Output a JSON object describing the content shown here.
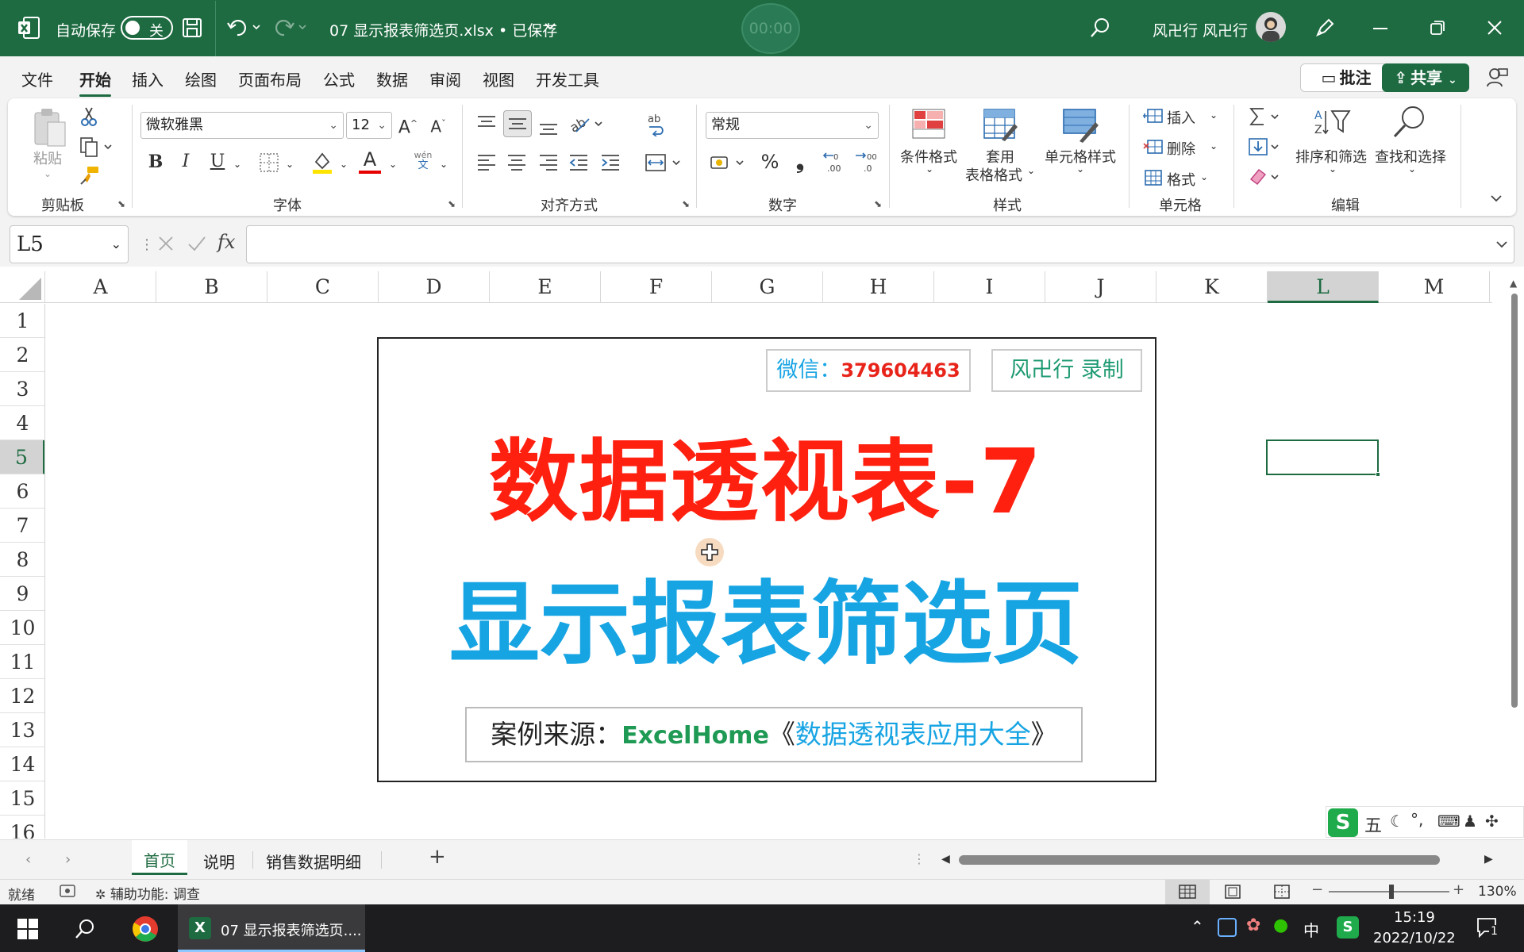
{
  "titlebar": {
    "autosave_label": "自动保存",
    "autosave_state": "关",
    "doc_title": "07 显示报表筛选页.xlsx • 已保存",
    "timer": "00:00",
    "user_name": "风卍行 风卍行",
    "accent_color": "#1e6b41"
  },
  "menu": {
    "items": [
      "文件",
      "开始",
      "插入",
      "绘图",
      "页面布局",
      "公式",
      "数据",
      "审阅",
      "视图",
      "开发工具"
    ],
    "active": "开始",
    "comment_label": "批注",
    "share_label": "共享"
  },
  "ribbon": {
    "clipboard": {
      "paste_label": "粘贴",
      "group_label": "剪贴板"
    },
    "font": {
      "font_name": "微软雅黑",
      "font_size": "12",
      "group_label": "字体",
      "bold": "B",
      "italic": "I",
      "underline": "U",
      "wen": "wén",
      "wen2": "文",
      "font_color_a": "A"
    },
    "alignment": {
      "group_label": "对齐方式"
    },
    "number": {
      "format": "常规",
      "group_label": "数字",
      "percent": "%",
      "comma": "❟"
    },
    "styles": {
      "conditional": "条件格式",
      "table_format_1": "套用",
      "table_format_2": "表格格式",
      "cell_styles": "单元格样式",
      "group_label": "样式"
    },
    "cells": {
      "insert": "插入",
      "delete": "删除",
      "format": "格式",
      "group_label": "单元格"
    },
    "editing": {
      "sort_filter": "排序和筛选",
      "find_select": "查找和选择",
      "group_label": "编辑"
    }
  },
  "formula_bar": {
    "name_box": "L5",
    "fx": "fx",
    "content": ""
  },
  "grid": {
    "columns": [
      "A",
      "B",
      "C",
      "D",
      "E",
      "F",
      "G",
      "H",
      "I",
      "J",
      "K",
      "L",
      "M"
    ],
    "rows": [
      "1",
      "2",
      "3",
      "4",
      "5",
      "6",
      "7",
      "8",
      "9",
      "10",
      "11",
      "12",
      "13",
      "14",
      "15",
      "16"
    ],
    "selected_col": "L",
    "selected_row": "5"
  },
  "slide": {
    "wechat_label": "微信：",
    "wechat_number": "379604463",
    "author": "风卍行 录制",
    "title_line1": "数据透视表-7",
    "title_line2": "显示报表筛选页",
    "source_prefix": "案例来源：",
    "source_brand": "ExcelHome",
    "source_book_open": "《",
    "source_book": "数据透视表应用大全",
    "source_book_close": "》",
    "title1_color": "#ff2010",
    "title2_color": "#17a4e3"
  },
  "sheets": {
    "tabs": [
      "首页",
      "说明",
      "销售数据明细"
    ],
    "active": "首页",
    "add": "+"
  },
  "ime": {
    "name": "五"
  },
  "statusbar": {
    "ready": "就绪",
    "accessibility": "辅助功能: 调查",
    "zoom": "130%"
  },
  "taskbar": {
    "app_title": "07 显示报表筛选页....",
    "time": "15:19",
    "date": "2022/10/22",
    "lang": "中",
    "notif_count": "1"
  }
}
